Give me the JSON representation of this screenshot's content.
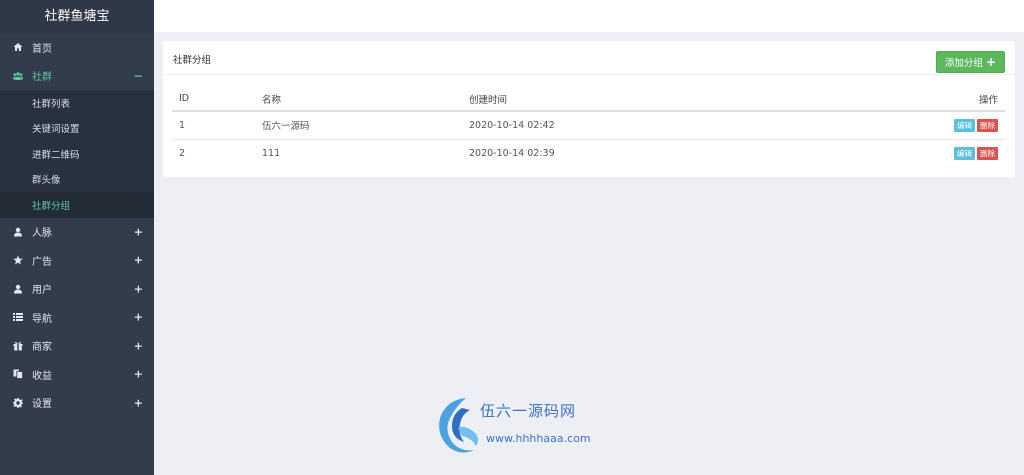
{
  "app": {
    "brand": "社群鱼塘宝"
  },
  "sidebar": {
    "items": [
      {
        "label": "首页",
        "icon": "home-icon",
        "toggle": ""
      },
      {
        "label": "社群",
        "icon": "users-icon",
        "toggle": "−",
        "children": [
          {
            "label": "社群列表"
          },
          {
            "label": "关键词设置"
          },
          {
            "label": "进群二维码"
          },
          {
            "label": "群头像"
          },
          {
            "label": "社群分组"
          }
        ]
      },
      {
        "label": "人脉",
        "icon": "user-icon",
        "toggle": "+"
      },
      {
        "label": "广告",
        "icon": "star-icon",
        "toggle": "+"
      },
      {
        "label": "用户",
        "icon": "user-icon",
        "toggle": "+"
      },
      {
        "label": "导航",
        "icon": "list-icon",
        "toggle": "+"
      },
      {
        "label": "商家",
        "icon": "gift-icon",
        "toggle": "+"
      },
      {
        "label": "收益",
        "icon": "copy-icon",
        "toggle": "+"
      },
      {
        "label": "设置",
        "icon": "gear-icon",
        "toggle": "+"
      }
    ]
  },
  "panel": {
    "title": "社群分组",
    "add_button": "添加分组",
    "add_icon": "+"
  },
  "table": {
    "headers": {
      "id": "ID",
      "name": "名称",
      "created": "创建时间",
      "ops": "操作"
    },
    "rows": [
      {
        "id": "1",
        "name": "伍六一源码",
        "created": "2020-10-14 02:42",
        "edit": "编辑",
        "delete": "删除"
      },
      {
        "id": "2",
        "name": "111",
        "created": "2020-10-14 02:39",
        "edit": "编辑",
        "delete": "删除"
      }
    ]
  },
  "watermark": {
    "title": "伍六一源码网",
    "url": "www.hhhhaaa.com"
  },
  "colors": {
    "sidebar": "#333c4a",
    "active": "#5fc6a3",
    "add": "#5cb85c",
    "edit": "#5bc0de",
    "delete": "#d9534f",
    "watermark": "#3b72c6"
  }
}
